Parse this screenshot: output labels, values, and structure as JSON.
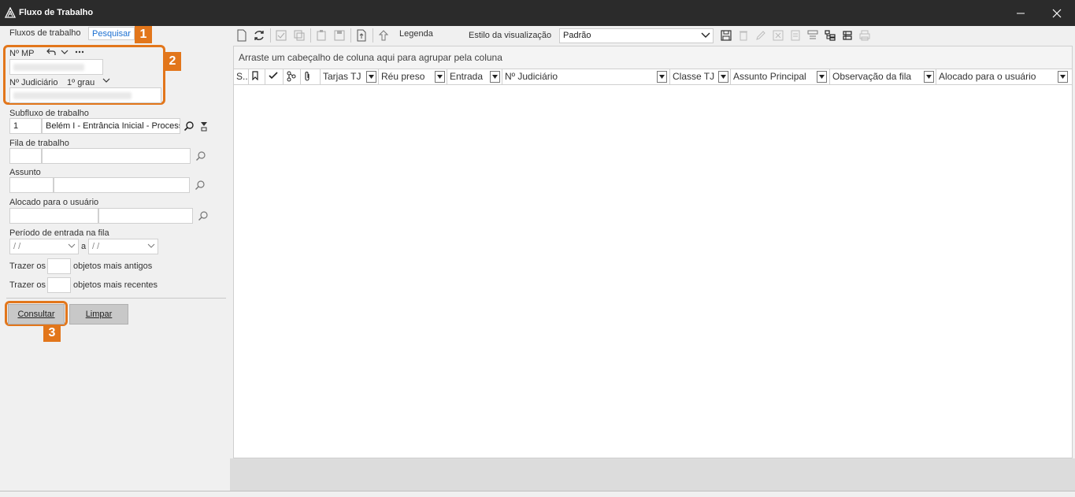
{
  "window": {
    "title": "Fluxo de Trabalho"
  },
  "tabs": {
    "flux": "Fluxos de trabalho",
    "search": "Pesquisar"
  },
  "callouts": {
    "one": "1",
    "two": "2",
    "three": "3"
  },
  "form": {
    "mp_label": "Nº MP",
    "jud_label": "Nº Judiciário",
    "degree": "1º grau",
    "subflow_label": "Subfluxo de trabalho",
    "subflow_code": "1",
    "subflow_name": "Belém I - Entrância Inicial - Process",
    "queue_label": "Fila de trabalho",
    "subject_label": "Assunto",
    "assigned_label": "Alocado para o usuário",
    "period_label": "Período de entrada na fila",
    "date_placeholder": " /  /",
    "date_sep": "a",
    "bring1": "Trazer os",
    "older": "objetos mais antigos",
    "bring2": "Trazer os",
    "newer": "objetos mais recentes",
    "search_btn": "Consultar",
    "clear_btn": "Limpar"
  },
  "toolbar": {
    "legend": "Legenda",
    "style_label": "Estilo da visualização",
    "style_value": "Padrão"
  },
  "grid": {
    "group_hint": "Arraste um cabeçalho de coluna aqui para agrupar pela coluna",
    "col_s": "S..",
    "col_tarjas": "Tarjas TJ",
    "col_reu": "Réu preso",
    "col_entrada": "Entrada",
    "col_njud": "Nº Judiciário",
    "col_classe": "Classe TJ",
    "col_assunto": "Assunto Principal",
    "col_obs": "Observação da fila",
    "col_alocado": "Alocado para o usuário"
  },
  "colors": {
    "accent": "#e2761b",
    "link": "#1a6fd1",
    "titlebar": "#2b2b2b"
  }
}
